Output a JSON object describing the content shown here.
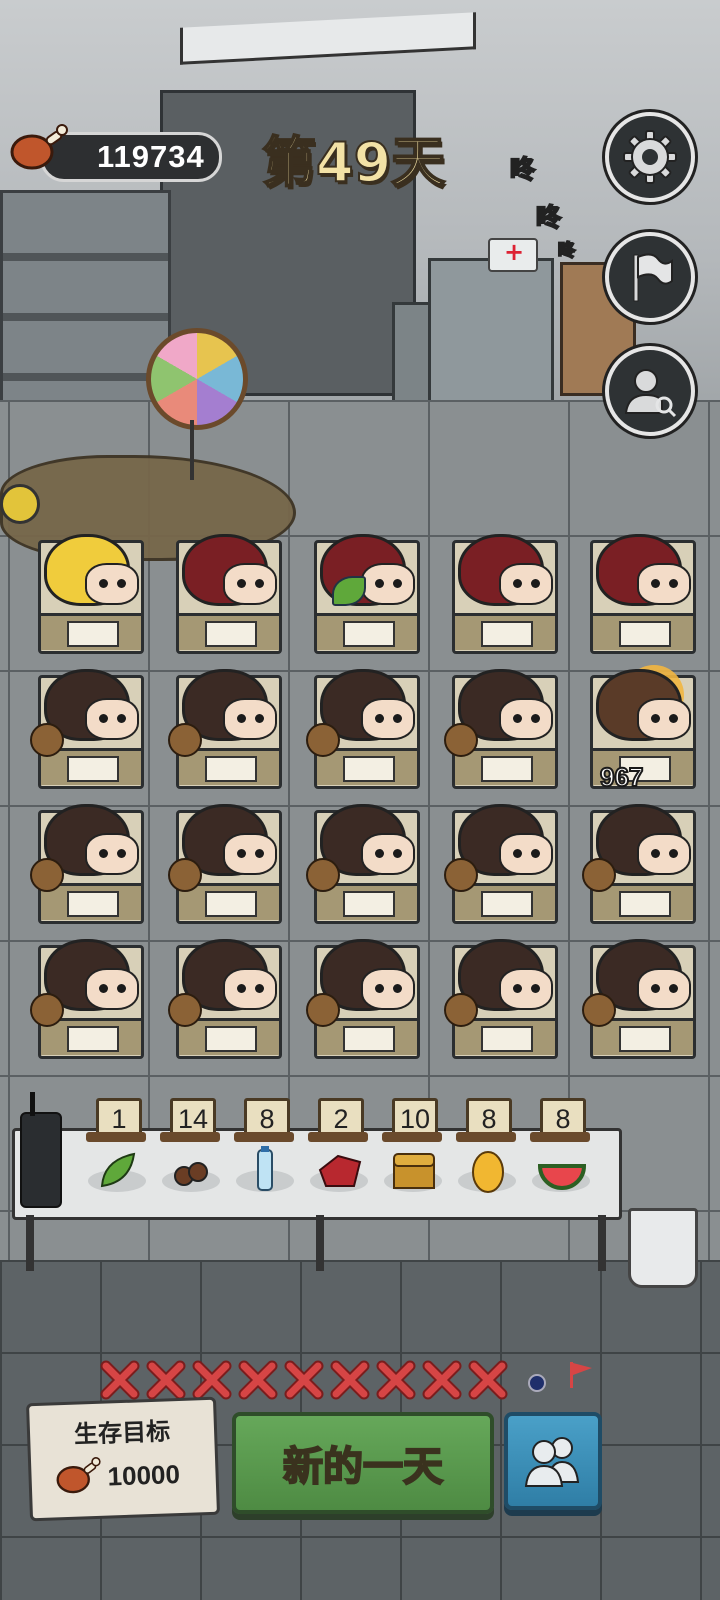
{
  "hud": {
    "resource_value": "119734",
    "resource_icon": "meat-icon",
    "day_label": "第49天",
    "buttons": [
      {
        "name": "settings-gear-icon"
      },
      {
        "name": "flag-icon"
      },
      {
        "name": "user-search-icon"
      }
    ]
  },
  "knock_sound": [
    "咚",
    "咚",
    "咚"
  ],
  "grid": {
    "rows": [
      [
        "blonde-vampire",
        "hooded-glasses",
        "hooded-glasses-leaf",
        "hooded-glasses",
        "hooded-glasses"
      ],
      [
        "ponytail",
        "ponytail",
        "ponytail",
        "ponytail",
        "injured-survivor"
      ],
      [
        "ponytail",
        "ponytail",
        "ponytail",
        "ponytail",
        "ponytail"
      ],
      [
        "ponytail",
        "ponytail",
        "ponytail",
        "ponytail",
        "ponytail"
      ]
    ],
    "hp_label": "967"
  },
  "inventory": [
    {
      "count": "1",
      "icon": "herb-leaf-icon"
    },
    {
      "count": "14",
      "icon": "mushroom-plate-icon"
    },
    {
      "count": "8",
      "icon": "water-bottle-icon"
    },
    {
      "count": "2",
      "icon": "raw-meat-icon"
    },
    {
      "count": "10",
      "icon": "treasure-chest-icon"
    },
    {
      "count": "8",
      "icon": "golden-egg-icon"
    },
    {
      "count": "8",
      "icon": "watermelon-icon"
    }
  ],
  "progress": {
    "failed_days": 9,
    "colors": {
      "cross": "#d64545",
      "dot": "#1f2f6b",
      "flag": "#d64545"
    }
  },
  "goal": {
    "label": "生存目标",
    "value": "10000"
  },
  "actions": {
    "new_day_label": "新的一天"
  },
  "colors": {
    "accent_green": "#4e8b43",
    "accent_blue": "#2f7ea6",
    "title_gold": "#f3e2a6"
  }
}
